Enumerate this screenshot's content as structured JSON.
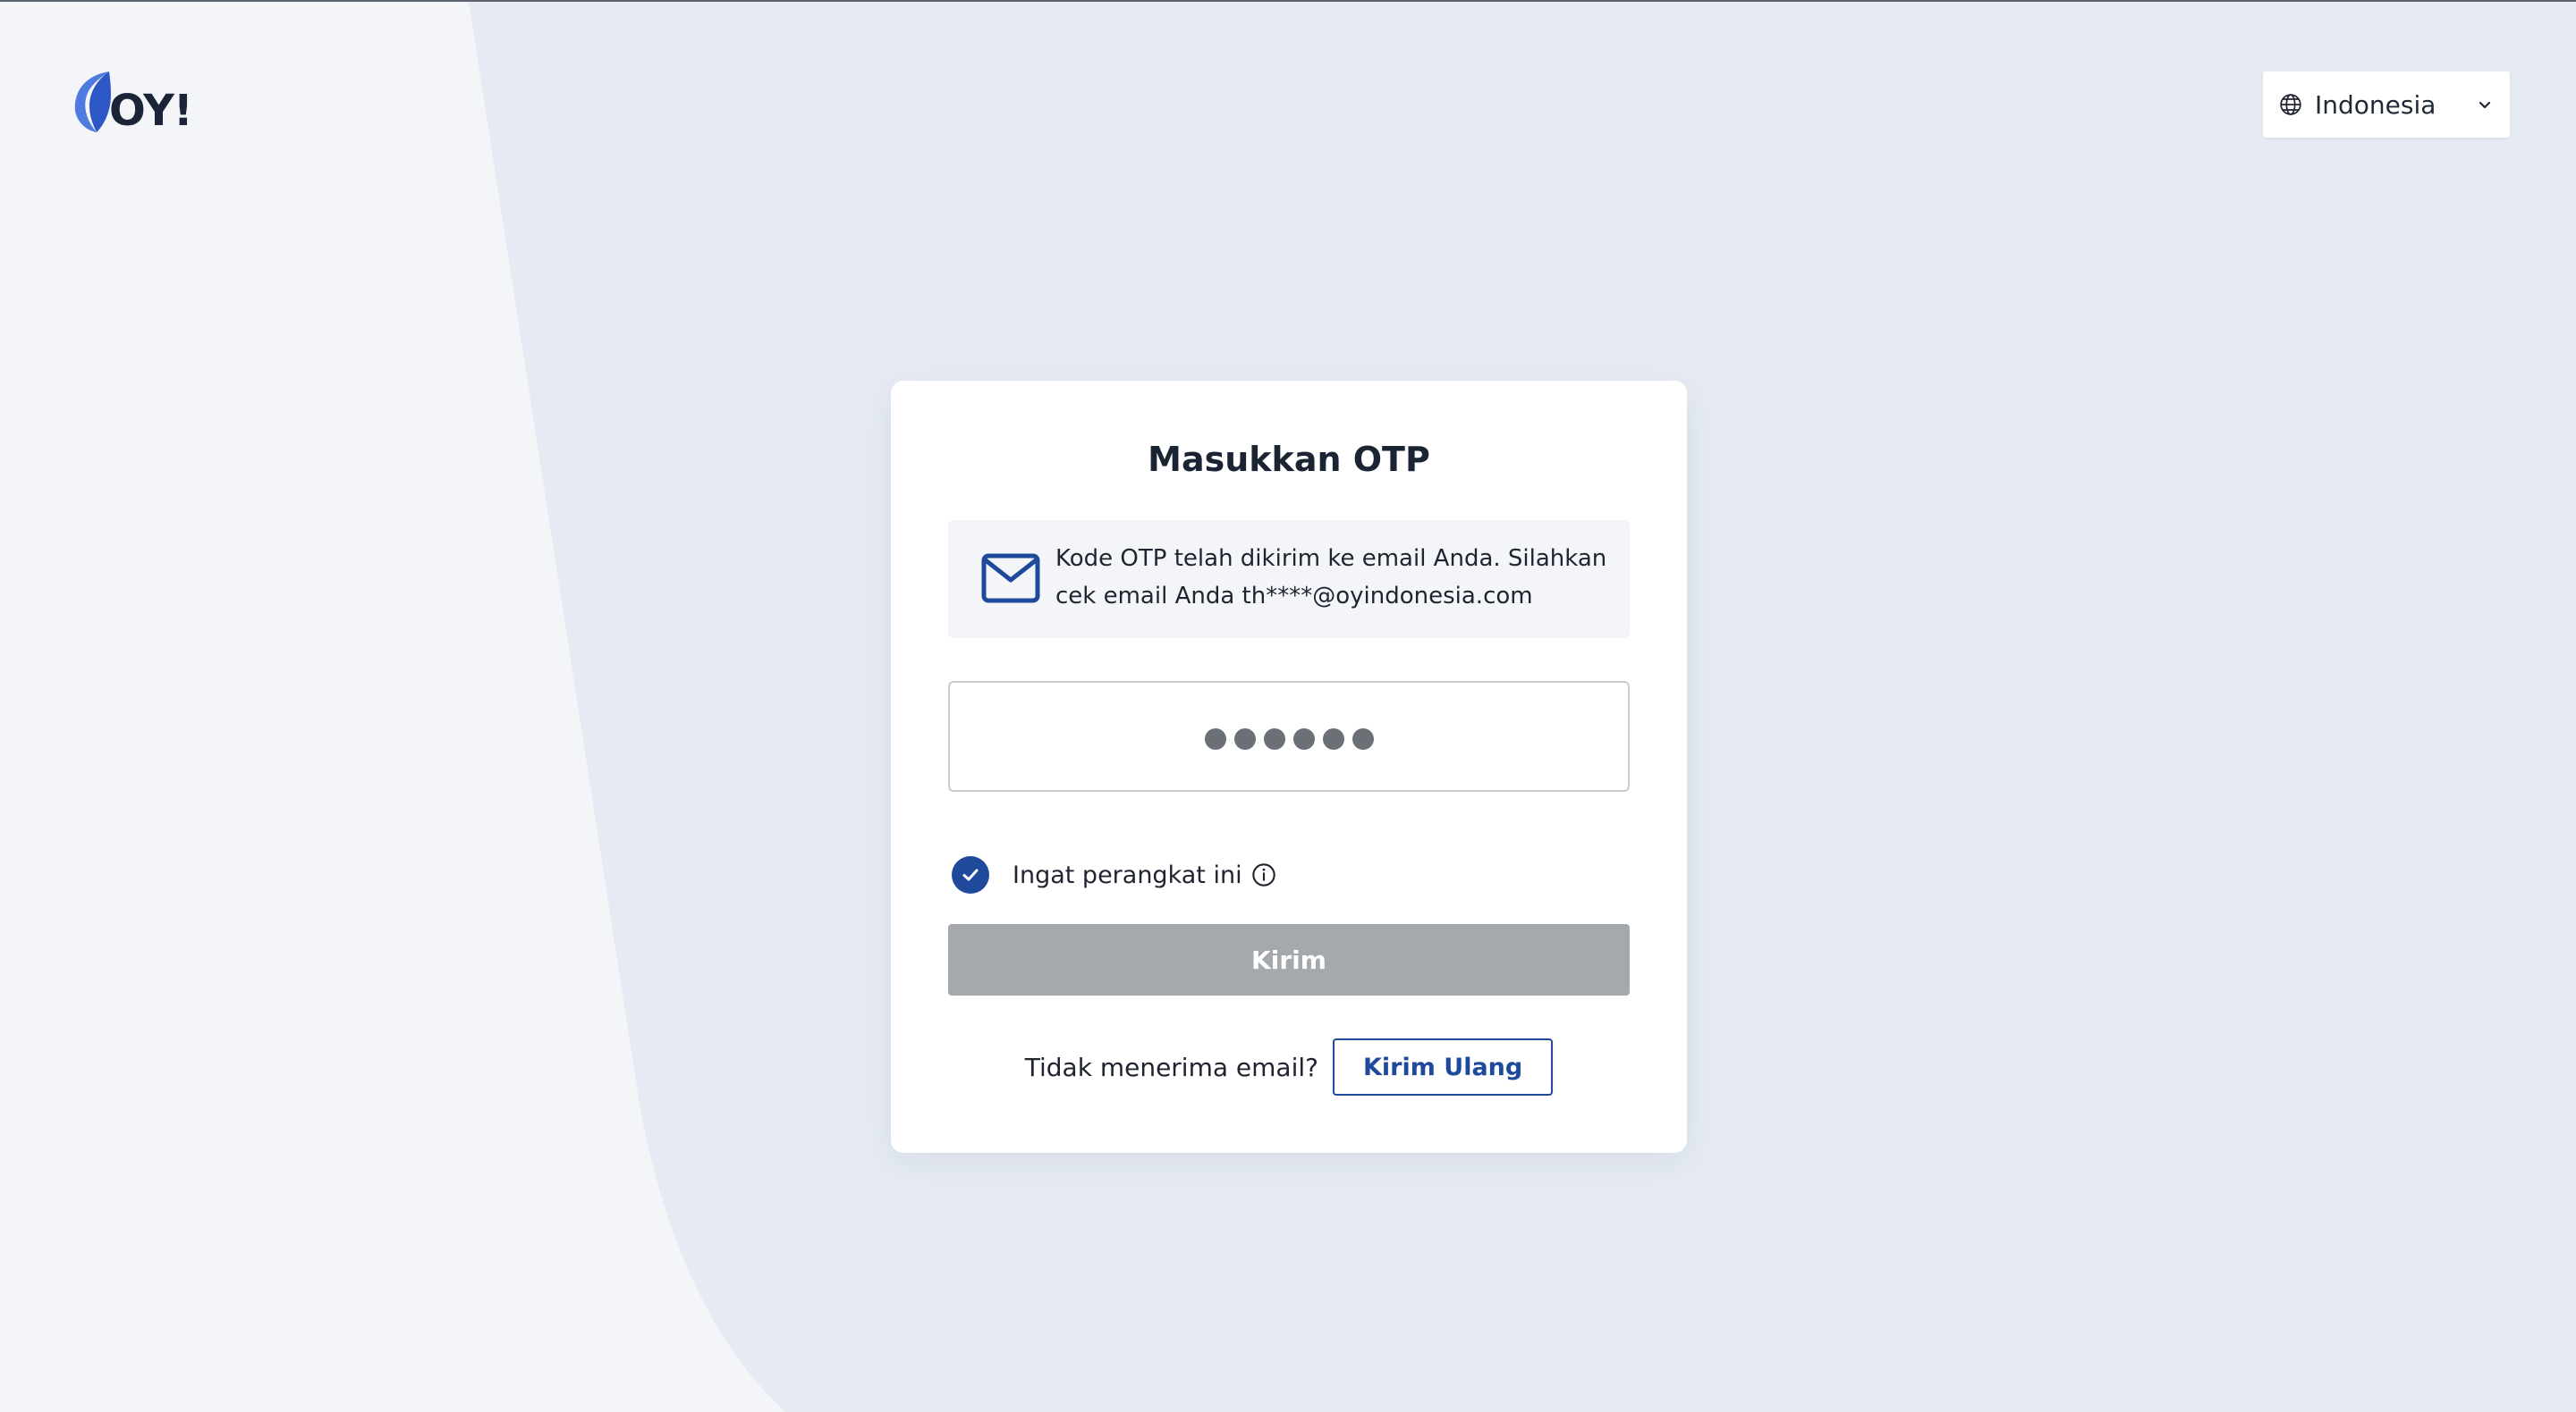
{
  "brand": {
    "logo_text": "OY!"
  },
  "language": {
    "selected": "Indonesia",
    "icon": "globe-icon",
    "caret_icon": "chevron-down-icon"
  },
  "otp_card": {
    "title": "Masukkan OTP",
    "notice_icon": "mail-icon",
    "notice_text": "Kode OTP telah dikirim ke email Anda. Silahkan cek email Anda th****@oyindonesia.com",
    "otp_masked_length": 6,
    "remember_device": {
      "label": "Ingat perangkat ini",
      "checked": true,
      "info_icon": "info-icon"
    },
    "submit_label": "Kirim",
    "resend_prompt": "Tidak menerima email?",
    "resend_label": "Kirim Ulang"
  },
  "colors": {
    "primary": "#1f4a9c",
    "page_bg": "#e6ebf3",
    "left_panel_bg": "#f3f5f9",
    "button_disabled": "#a5a8ad",
    "logo_leaf": "#4f7be0"
  }
}
